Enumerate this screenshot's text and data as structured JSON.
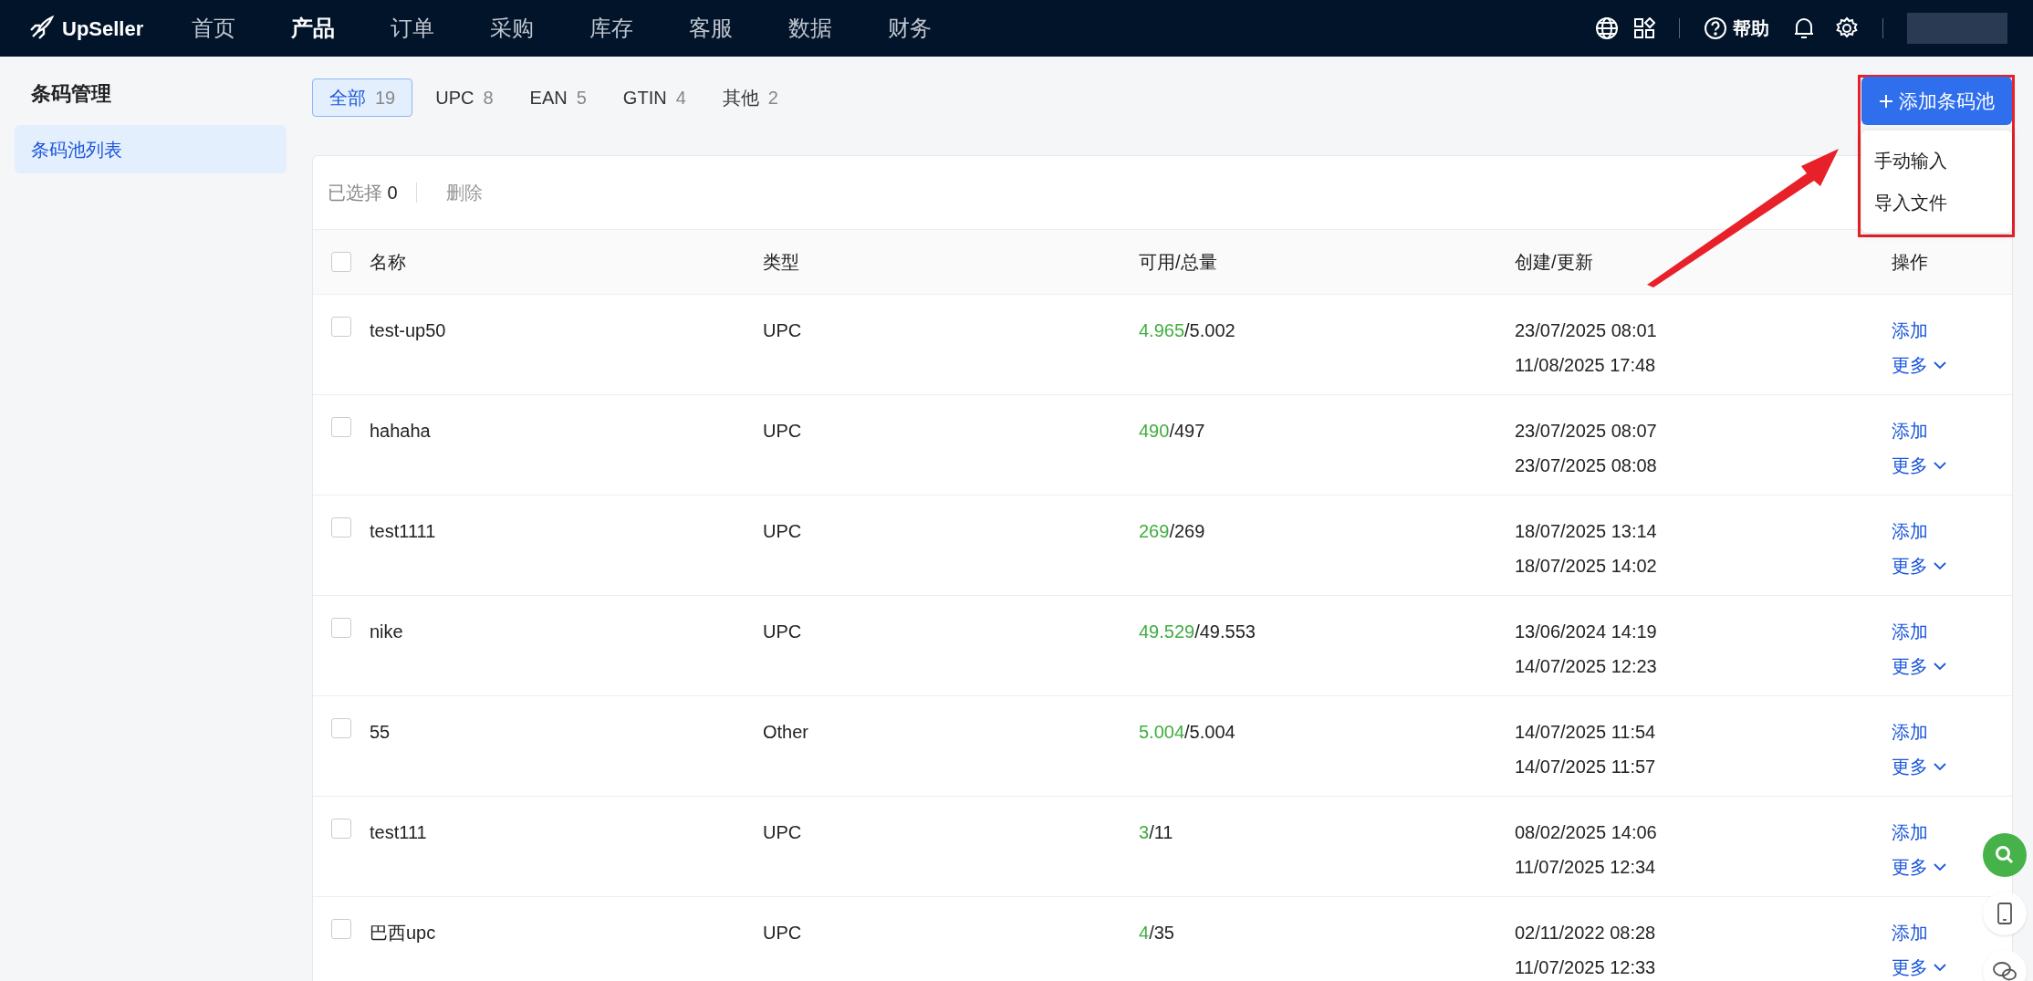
{
  "navbar": {
    "logo": "UpSeller",
    "items": [
      {
        "label": "首页",
        "selected": false
      },
      {
        "label": "产品",
        "selected": true
      },
      {
        "label": "订单",
        "selected": false
      },
      {
        "label": "采购",
        "selected": false
      },
      {
        "label": "库存",
        "selected": false
      },
      {
        "label": "客服",
        "selected": false
      },
      {
        "label": "数据",
        "selected": false
      },
      {
        "label": "财务",
        "selected": false
      }
    ],
    "help": "帮助"
  },
  "sidebar": {
    "title": "条码管理",
    "items": [
      {
        "label": "条码池列表",
        "selected": true
      }
    ]
  },
  "tabs": [
    {
      "label": "全部",
      "count": "19",
      "selected": true
    },
    {
      "label": "UPC",
      "count": "8",
      "selected": false
    },
    {
      "label": "EAN",
      "count": "5",
      "selected": false
    },
    {
      "label": "GTIN",
      "count": "4",
      "selected": false
    },
    {
      "label": "其他",
      "count": "2",
      "selected": false
    }
  ],
  "add_button": {
    "label": "添加条码池",
    "menu": [
      "手动输入",
      "导入文件"
    ]
  },
  "toolbar": {
    "selected_label": "已选择",
    "selected_count": "0",
    "delete": "删除"
  },
  "table": {
    "select_all_checked": false,
    "columns": [
      "名称",
      "类型",
      "可用/总量",
      "创建/更新",
      "操作"
    ],
    "rows": [
      {
        "name": "test-up50",
        "type": "UPC",
        "available": "4.965",
        "total": "/5.002",
        "checked": false,
        "created": "23/07/2025 08:01",
        "updated": "11/08/2025 17:48",
        "add": "添加",
        "more": "更多"
      },
      {
        "name": "hahaha",
        "type": "UPC",
        "available": "490",
        "total": "/497",
        "checked": false,
        "created": "23/07/2025 08:07",
        "updated": "23/07/2025 08:08",
        "add": "添加",
        "more": "更多"
      },
      {
        "name": "test1111",
        "type": "UPC",
        "available": "269",
        "total": "/269",
        "checked": false,
        "created": "18/07/2025 13:14",
        "updated": "18/07/2025 14:02",
        "add": "添加",
        "more": "更多"
      },
      {
        "name": "nike",
        "type": "UPC",
        "available": "49.529",
        "total": "/49.553",
        "checked": false,
        "created": "13/06/2024 14:19",
        "updated": "14/07/2025 12:23",
        "add": "添加",
        "more": "更多"
      },
      {
        "name": "55",
        "type": "Other",
        "available": "5.004",
        "total": "/5.004",
        "checked": false,
        "created": "14/07/2025 11:54",
        "updated": "14/07/2025 11:57",
        "add": "添加",
        "more": "更多"
      },
      {
        "name": "test111",
        "type": "UPC",
        "available": "3",
        "total": "/11",
        "checked": false,
        "created": "08/02/2025 14:06",
        "updated": "11/07/2025 12:34",
        "add": "添加",
        "more": "更多"
      },
      {
        "name": "巴西upc",
        "type": "UPC",
        "available": "4",
        "total": "/35",
        "checked": false,
        "created": "02/11/2022 08:28",
        "updated": "11/07/2025 12:33",
        "add": "添加",
        "more": "更多"
      }
    ]
  }
}
